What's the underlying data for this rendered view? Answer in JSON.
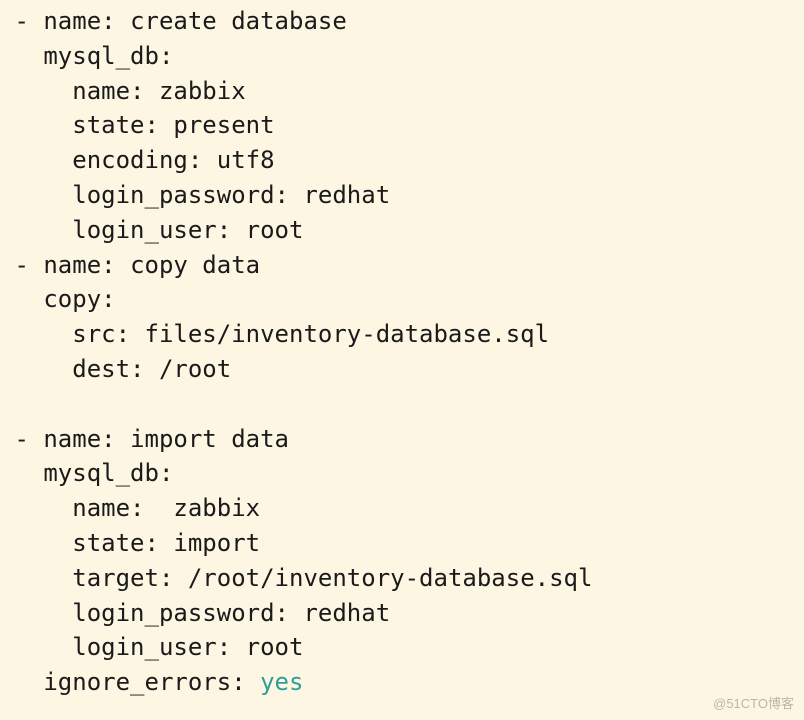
{
  "lines": [
    {
      "indent": " ",
      "dash": "- ",
      "key": "name:",
      "sep": " ",
      "value": "create database"
    },
    {
      "indent": "   ",
      "dash": "",
      "key": "mysql_db:",
      "sep": "",
      "value": ""
    },
    {
      "indent": "     ",
      "dash": "",
      "key": "name:",
      "sep": " ",
      "value": "zabbix"
    },
    {
      "indent": "     ",
      "dash": "",
      "key": "state:",
      "sep": " ",
      "value": "present"
    },
    {
      "indent": "     ",
      "dash": "",
      "key": "encoding:",
      "sep": " ",
      "value": "utf8"
    },
    {
      "indent": "     ",
      "dash": "",
      "key": "login_password:",
      "sep": " ",
      "value": "redhat"
    },
    {
      "indent": "     ",
      "dash": "",
      "key": "login_user:",
      "sep": " ",
      "value": "root"
    },
    {
      "indent": " ",
      "dash": "- ",
      "key": "name:",
      "sep": " ",
      "value": "copy data"
    },
    {
      "indent": "   ",
      "dash": "",
      "key": "copy:",
      "sep": "",
      "value": ""
    },
    {
      "indent": "     ",
      "dash": "",
      "key": "src:",
      "sep": " ",
      "value": "files/inventory-database.sql"
    },
    {
      "indent": "     ",
      "dash": "",
      "key": "dest:",
      "sep": " ",
      "value": "/root"
    },
    {
      "indent": "",
      "dash": "",
      "key": "",
      "sep": "",
      "value": ""
    },
    {
      "indent": " ",
      "dash": "- ",
      "key": "name:",
      "sep": " ",
      "value": "import data"
    },
    {
      "indent": "   ",
      "dash": "",
      "key": "mysql_db:",
      "sep": "",
      "value": ""
    },
    {
      "indent": "     ",
      "dash": "",
      "key": "name:",
      "sep": "  ",
      "value": "zabbix"
    },
    {
      "indent": "     ",
      "dash": "",
      "key": "state:",
      "sep": " ",
      "value": "import"
    },
    {
      "indent": "     ",
      "dash": "",
      "key": "target:",
      "sep": " ",
      "value": "/root/inventory-database.sql"
    },
    {
      "indent": "     ",
      "dash": "",
      "key": "login_password:",
      "sep": " ",
      "value": "redhat"
    },
    {
      "indent": "     ",
      "dash": "",
      "key": "login_user:",
      "sep": " ",
      "value": "root"
    },
    {
      "indent": "   ",
      "dash": "",
      "key": "ignore_errors:",
      "sep": " ",
      "value": "yes",
      "value_class": "bool-val"
    }
  ],
  "watermark": "@51CTO博客"
}
